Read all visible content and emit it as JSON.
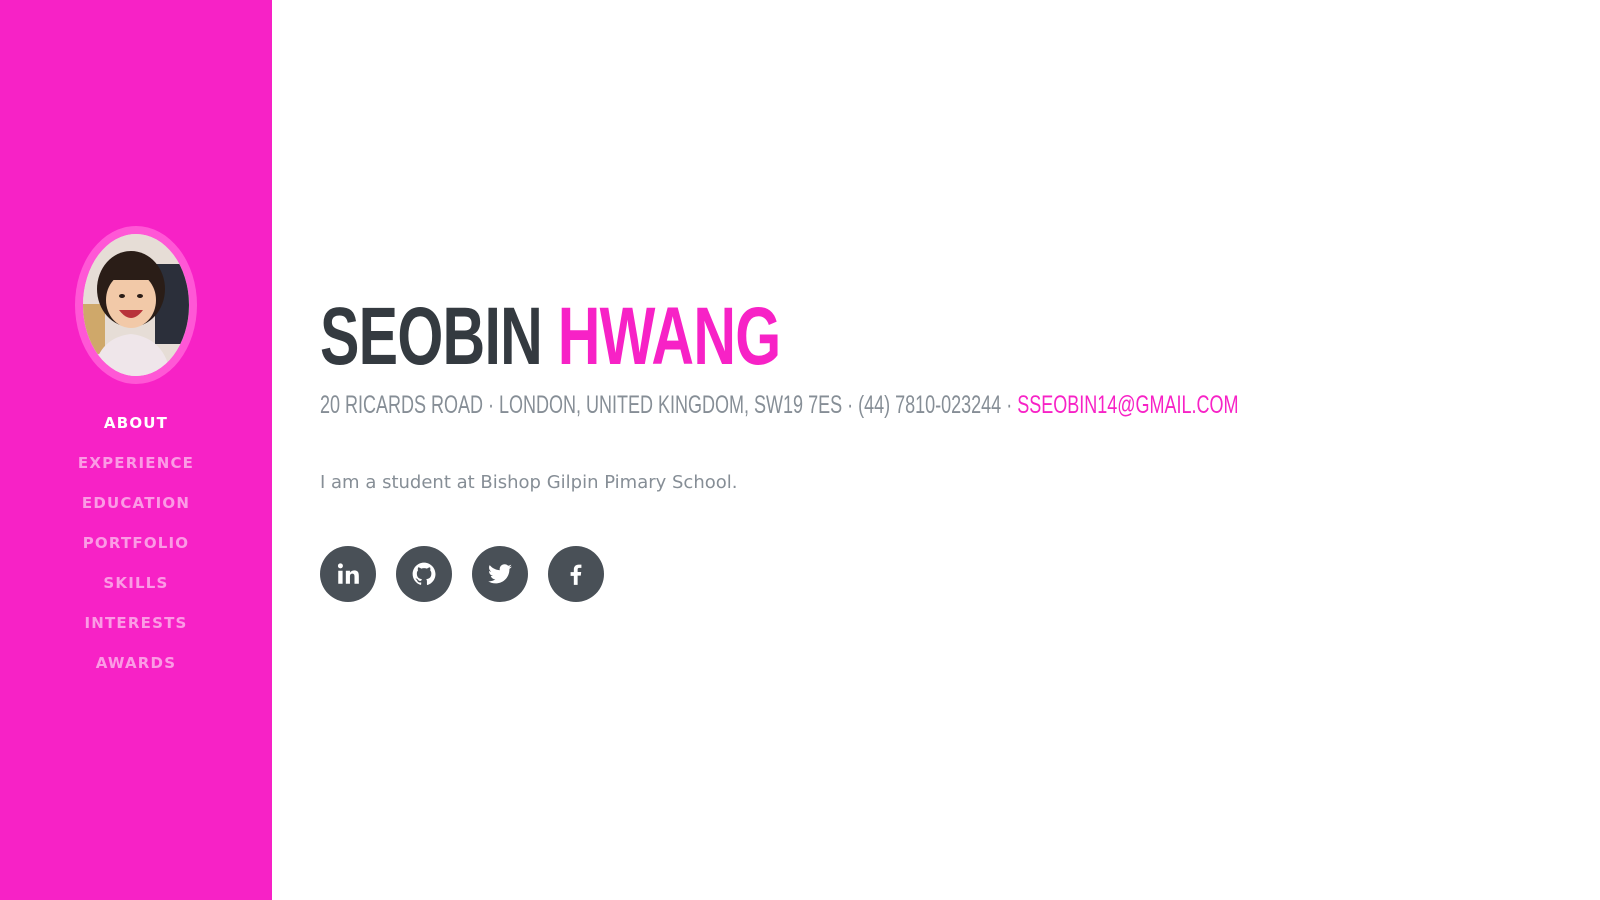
{
  "sidebar": {
    "background": "#f722c6",
    "nav": [
      {
        "label": "ABOUT",
        "active": true
      },
      {
        "label": "EXPERIENCE"
      },
      {
        "label": "EDUCATION"
      },
      {
        "label": "PORTFOLIO"
      },
      {
        "label": "SKILLS"
      },
      {
        "label": "INTERESTS"
      },
      {
        "label": "AWARDS"
      }
    ]
  },
  "about": {
    "first_name": "SEOBIN",
    "last_name": "HWANG",
    "address": "20 RICARDS ROAD · LONDON, UNITED KINGDOM, SW19 7ES · (44) 7810-023244 ·",
    "email": "SSEOBIN14@GMAIL.COM",
    "bio": "I am a student at Bishop Gilpin Pimary School."
  },
  "social": [
    {
      "name": "linkedin-icon"
    },
    {
      "name": "github-icon"
    },
    {
      "name": "twitter-icon"
    },
    {
      "name": "facebook-icon"
    }
  ],
  "colors": {
    "accent": "#f722c6",
    "heading": "#343a40",
    "muted": "#868e96",
    "social_bg": "#495057"
  }
}
